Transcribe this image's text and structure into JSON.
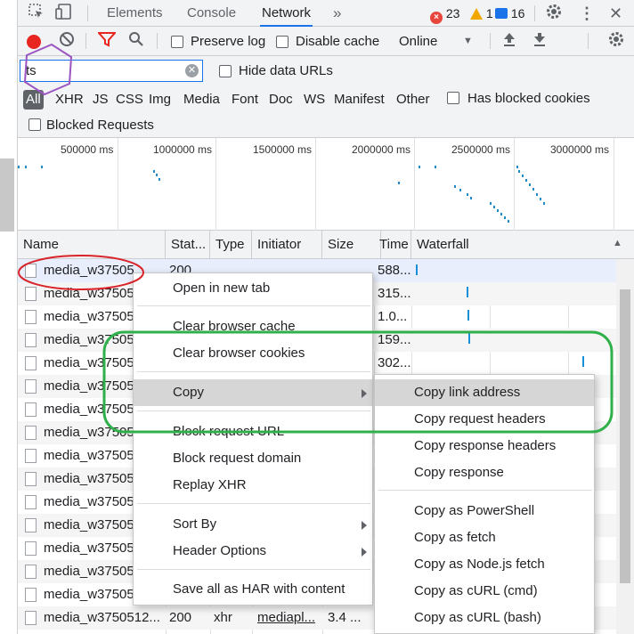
{
  "tabs": {
    "elements": "Elements",
    "console": "Console",
    "network": "Network",
    "more": "»"
  },
  "status": {
    "errors": "23",
    "warnings": "1",
    "messages": "16"
  },
  "toolbar": {
    "preserve_log": "Preserve log",
    "disable_cache": "Disable cache",
    "throttle": "Online"
  },
  "filter": {
    "value": "ts",
    "hide_data_urls": "Hide data URLs"
  },
  "types": [
    "All",
    "XHR",
    "JS",
    "CSS",
    "Img",
    "Media",
    "Font",
    "Doc",
    "WS",
    "Manifest",
    "Other"
  ],
  "has_blocked_cookies": "Has blocked cookies",
  "blocked_requests": "Blocked Requests",
  "overview": {
    "ticks": [
      "500000 ms",
      "1000000 ms",
      "1500000 ms",
      "2000000 ms",
      "2500000 ms",
      "3000000 ms"
    ]
  },
  "columns": {
    "name": "Name",
    "status": "Stat...",
    "type": "Type",
    "initiator": "Initiator",
    "size": "Size",
    "time": "Time",
    "waterfall": "Waterfall"
  },
  "rows": [
    {
      "name": "media_w37505",
      "status": "200",
      "time": "588..."
    },
    {
      "name": "media_w37505",
      "status": "",
      "time": "315..."
    },
    {
      "name": "media_w37505",
      "status": "",
      "time": "1.0..."
    },
    {
      "name": "media_w37505",
      "status": "",
      "time": "159..."
    },
    {
      "name": "media_w37505",
      "status": "",
      "time": "302..."
    },
    {
      "name": "media_w37505",
      "status": "",
      "time": ""
    },
    {
      "name": "media_w37505",
      "status": "",
      "time": ""
    },
    {
      "name": "media_w37505",
      "status": "",
      "time": ""
    },
    {
      "name": "media_w37505",
      "status": "",
      "time": ""
    },
    {
      "name": "media_w37505",
      "status": "",
      "time": ""
    },
    {
      "name": "media_w37505",
      "status": "",
      "time": ""
    },
    {
      "name": "media_w37505",
      "status": "",
      "time": ""
    },
    {
      "name": "media_w37505",
      "status": "",
      "time": ""
    },
    {
      "name": "media_w37505",
      "status": "",
      "time": ""
    },
    {
      "name": "media_w37505",
      "status": "",
      "time": ""
    },
    {
      "name": "media_w3750512...",
      "status": "200",
      "type": "xhr",
      "initiator": "mediapl...",
      "size": "3.4 ..."
    }
  ],
  "context_menu": {
    "open_new_tab": "Open in new tab",
    "clear_cache": "Clear browser cache",
    "clear_cookies": "Clear browser cookies",
    "copy": "Copy",
    "block_url": "Block request URL",
    "block_domain": "Block request domain",
    "replay_xhr": "Replay XHR",
    "sort_by": "Sort By",
    "header_options": "Header Options",
    "save_har": "Save all as HAR with content"
  },
  "copy_submenu": {
    "copy_link": "Copy link address",
    "copy_req_headers": "Copy request headers",
    "copy_resp_headers": "Copy response headers",
    "copy_response": "Copy response",
    "copy_powershell": "Copy as PowerShell",
    "copy_fetch": "Copy as fetch",
    "copy_node_fetch": "Copy as Node.js fetch",
    "copy_curl_cmd": "Copy as cURL (cmd)",
    "copy_curl_bash": "Copy as cURL (bash)"
  },
  "colors": {
    "accent": "#1a73e8",
    "record": "#e8251f",
    "annotation_red": "#d9242a",
    "annotation_purple": "#9b55c2",
    "annotation_green": "#2fb04a"
  }
}
